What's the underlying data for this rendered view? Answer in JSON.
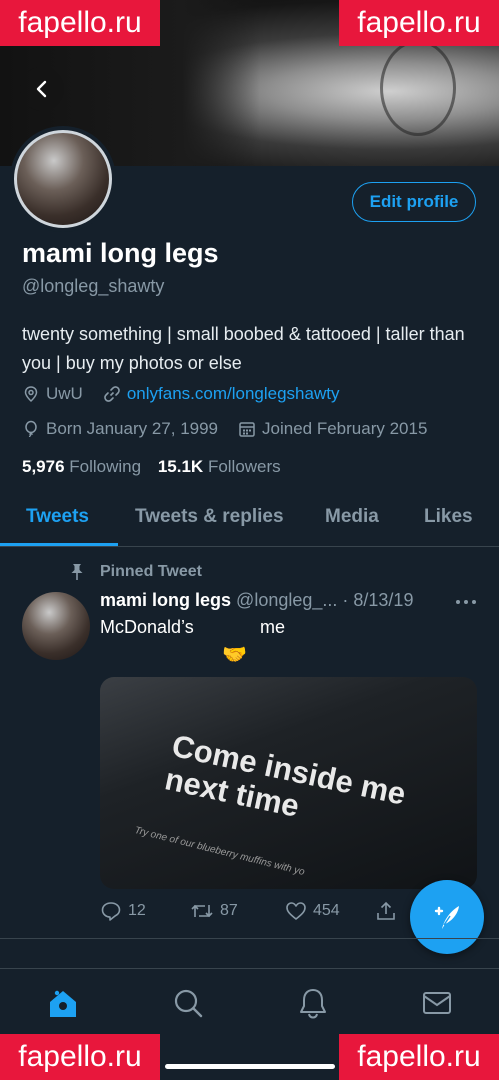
{
  "watermark": {
    "text": "fapello.ru"
  },
  "profile": {
    "edit_label": "Edit profile",
    "name": "mami long legs",
    "handle": "@longleg_shawty",
    "bio": "twenty something | small boobed & tattooed | taller than you | buy my photos or else",
    "location": "UwU",
    "website": "onlyfans.com/longlegshawty",
    "born": "Born January 27, 1999",
    "joined": "Joined February 2015",
    "following_count": "5,976",
    "following_label": "Following",
    "followers_count": "15.1K",
    "followers_label": "Followers"
  },
  "tabs": [
    {
      "label": "Tweets"
    },
    {
      "label": "Tweets & replies"
    },
    {
      "label": "Media"
    },
    {
      "label": "Likes"
    }
  ],
  "tweet": {
    "pinned_label": "Pinned Tweet",
    "author_name": "mami long legs",
    "author_handle": "@longleg_...",
    "date": "· 8/13/19",
    "text_before": "McDonald’s",
    "emoji": "🤝",
    "text_after": "me",
    "media_text_line1": "Come inside me",
    "media_text_line2": "next time",
    "media_small_text": "Try one of our blueberry muffins with yo",
    "replies": "12",
    "retweets": "87",
    "likes": "454"
  },
  "colors": {
    "accent": "#1da1f2",
    "background": "#15202b",
    "muted": "#8899a6",
    "watermark": "#e8173c"
  },
  "icons": [
    "back-arrow-icon",
    "location-icon",
    "link-icon",
    "balloon-icon",
    "calendar-icon",
    "pin-icon",
    "more-icon",
    "reply-icon",
    "retweet-icon",
    "like-icon",
    "share-icon",
    "compose-icon",
    "home-icon",
    "search-icon",
    "notifications-icon",
    "messages-icon"
  ]
}
